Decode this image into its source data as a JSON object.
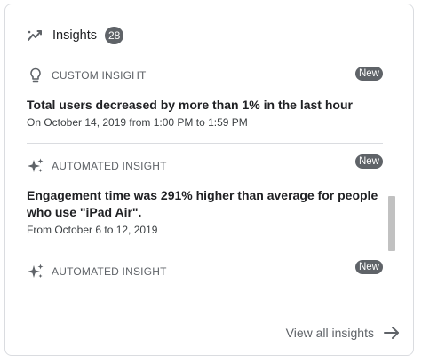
{
  "header": {
    "title": "Insights",
    "count": "28",
    "icon": "trending-line-icon"
  },
  "items": [
    {
      "type_label": "CUSTOM INSIGHT",
      "icon": "lightbulb-icon",
      "badge": "New",
      "headline": "Total users decreased by more than 1% in the last hour",
      "detail": "On October 14, 2019 from 1:00 PM to 1:59 PM"
    },
    {
      "type_label": "AUTOMATED INSIGHT",
      "icon": "sparkle-icon",
      "badge": "New",
      "headline": "Engagement time was 291% higher than average for people who use \"iPad Air\".",
      "detail": "From October 6 to 12, 2019"
    },
    {
      "type_label": "AUTOMATED INSIGHT",
      "icon": "sparkle-icon",
      "badge": "New"
    }
  ],
  "footer": {
    "view_all_label": "View all insights",
    "icon": "arrow-right-icon"
  },
  "colors": {
    "badge_bg": "#5f6368",
    "divider": "#dadce0",
    "text_primary": "#202124",
    "text_secondary": "#5f6368"
  }
}
